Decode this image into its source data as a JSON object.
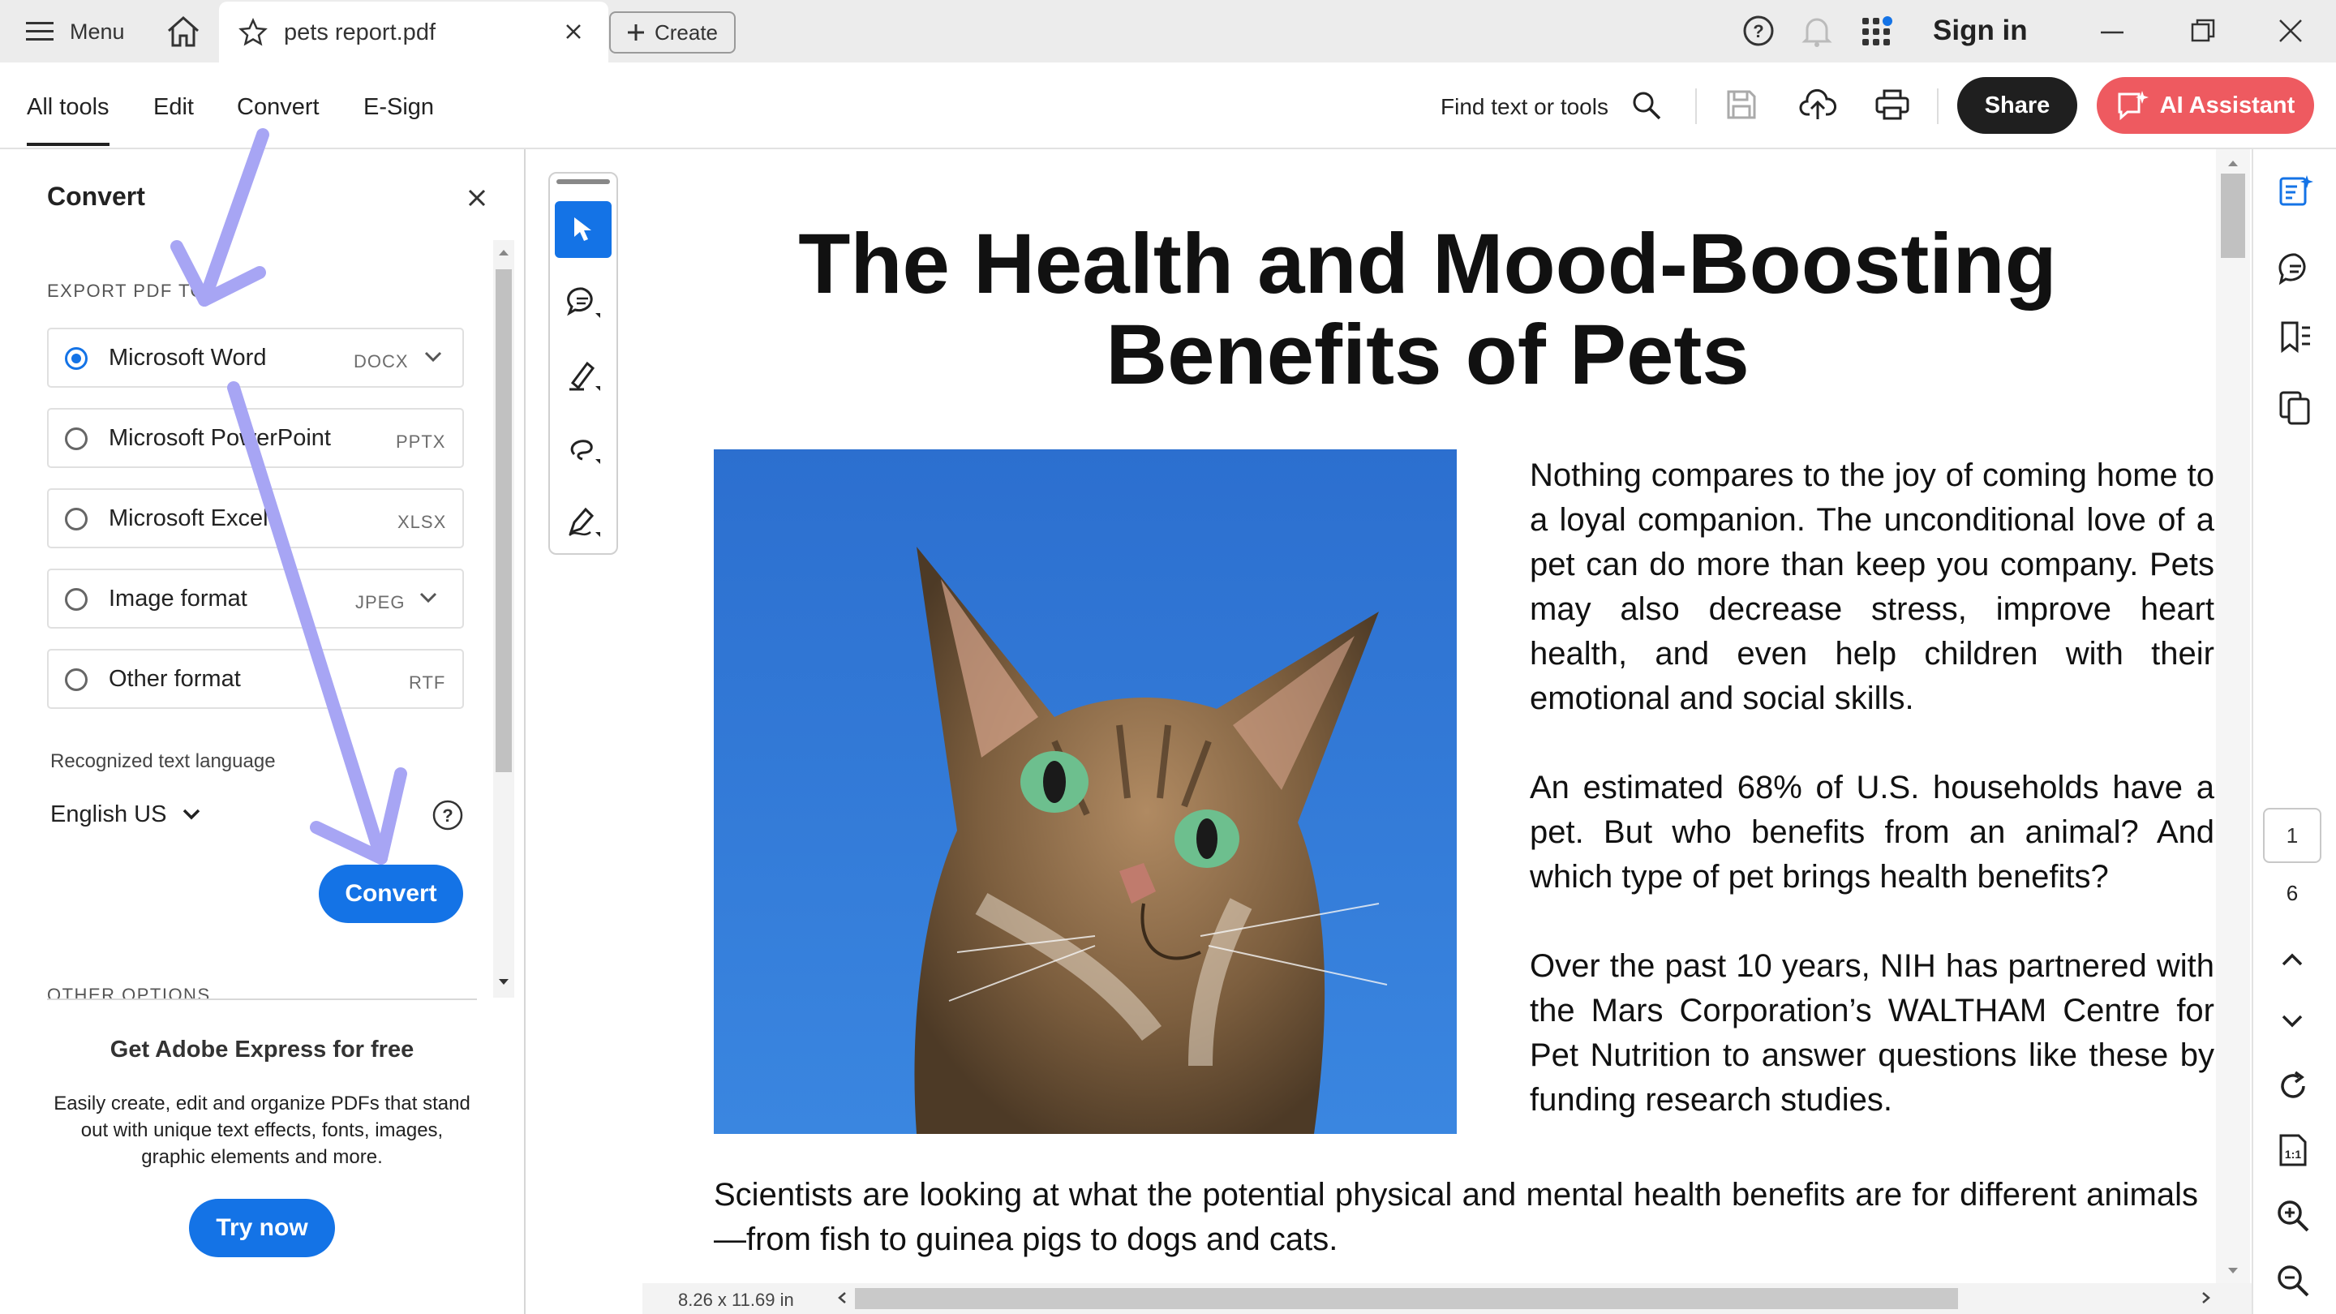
{
  "titlebar": {
    "menu_label": "Menu",
    "tab_title": "pets report.pdf",
    "create_label": "Create",
    "signin_label": "Sign in"
  },
  "toolbar": {
    "tabs": [
      "All tools",
      "Edit",
      "Convert",
      "E-Sign"
    ],
    "active_tab": "All tools",
    "find_label": "Find text or tools",
    "share_label": "Share",
    "ai_label": "AI Assistant",
    "ai_color": "#ee5a60"
  },
  "panel": {
    "title": "Convert",
    "export_heading": "EXPORT PDF TO",
    "options": [
      {
        "label": "Microsoft Word",
        "format": "DOCX",
        "selected": true,
        "has_dropdown": true
      },
      {
        "label": "Microsoft PowerPoint",
        "format": "PPTX",
        "selected": false,
        "has_dropdown": false
      },
      {
        "label": "Microsoft Excel",
        "format": "XLSX",
        "selected": false,
        "has_dropdown": false
      },
      {
        "label": "Image format",
        "format": "JPEG",
        "selected": false,
        "has_dropdown": true
      },
      {
        "label": "Other format",
        "format": "RTF",
        "selected": false,
        "has_dropdown": false
      }
    ],
    "language_heading": "Recognized text language",
    "language_value": "English US",
    "convert_label": "Convert",
    "other_options_heading": "OTHER OPTIONS",
    "promo_title": "Get Adobe Express for free",
    "promo_lines": [
      "Easily create, edit and organize PDFs that stand",
      "out with unique text effects, fonts, images,",
      "graphic elements and more."
    ],
    "try_label": "Try now",
    "accent_color": "#1473e6"
  },
  "document": {
    "title_line1": "The Health and Mood-Boosting",
    "title_line2": "Benefits of Pets",
    "para1": "Nothing compares to the joy of coming home to a loyal companion. The unconditional love of a pet can do more than keep you company. Pets may also decrease stress, improve heart health, and even help children with their emotional and social skills.",
    "para2": "An estimated 68% of U.S. households have a pet. But who benefits from an animal? And which type of pet brings health benefits?",
    "para3": "Over the past 10 years, NIH has partnered with the Mars Corporation’s WALTHAM Centre for Pet Nutrition to answer questions like these by funding research studies.",
    "para4": "Scientists are looking at what the potential physical and mental health benefits are for different animals—from fish to guinea pigs to dogs and cats.",
    "page_size": "8.26 x 11.69 in"
  },
  "pager": {
    "current_page": "1",
    "total_pages": "6"
  },
  "annotation_color": "#a7a5f4"
}
